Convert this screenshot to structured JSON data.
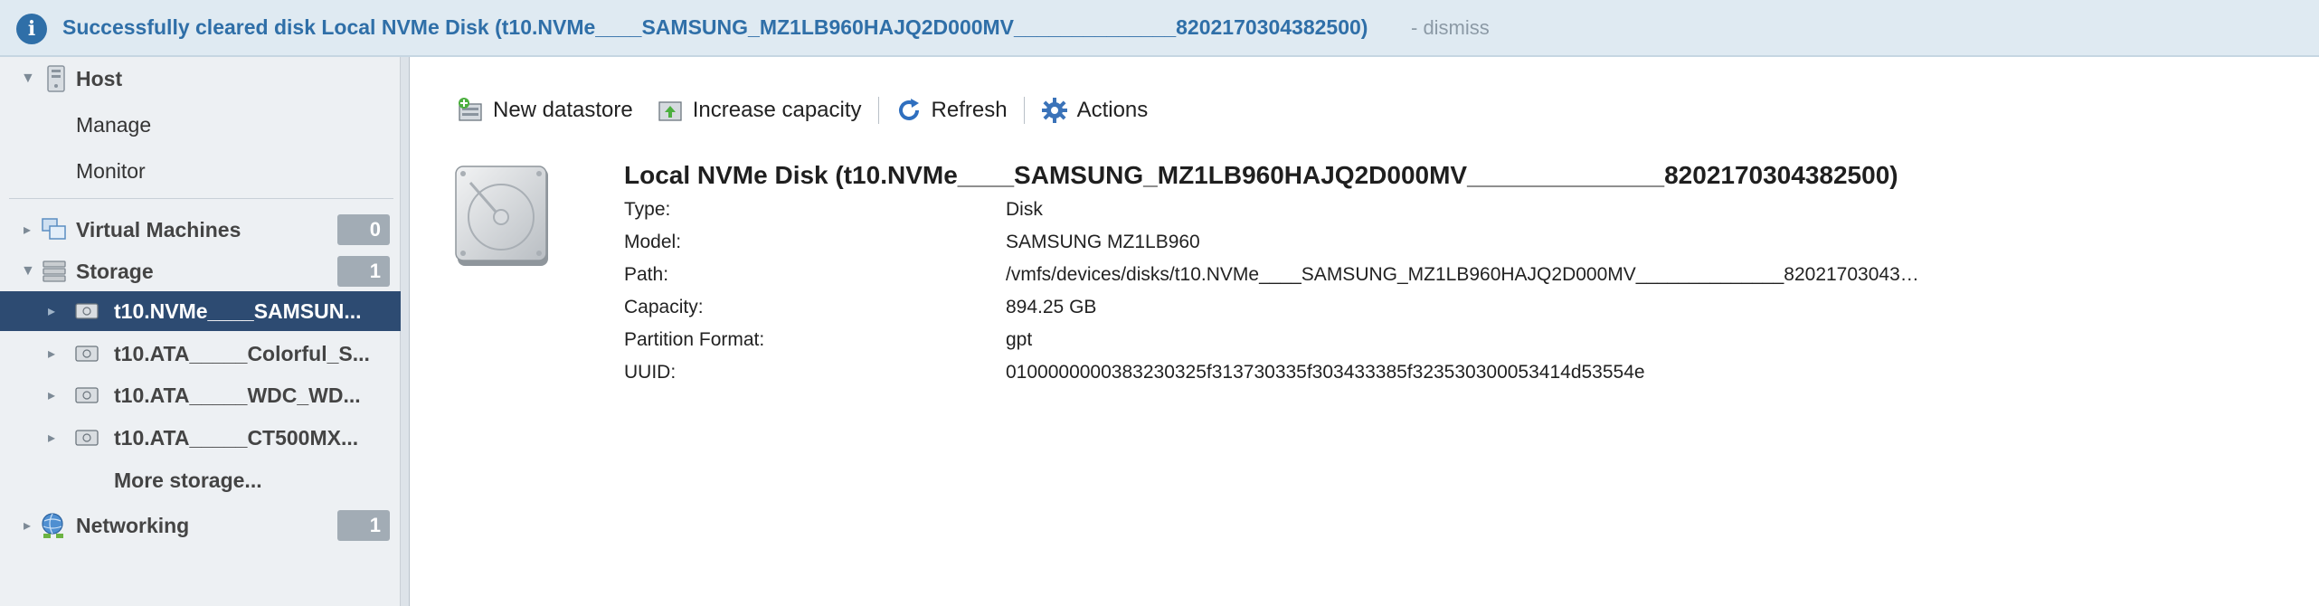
{
  "banner": {
    "message": "Successfully cleared disk Local NVMe Disk (t10.NVMe____SAMSUNG_MZ1LB960HAJQ2D000MV______________8202170304382500)",
    "dismiss": "- dismiss"
  },
  "sidebar": {
    "host": {
      "label": "Host",
      "items": [
        "Manage",
        "Monitor"
      ]
    },
    "virtual_machines": {
      "label": "Virtual Machines",
      "count": "0"
    },
    "storage": {
      "label": "Storage",
      "count": "1",
      "items": [
        "t10.NVMe____SAMSUN...",
        "t10.ATA_____Colorful_S...",
        "t10.ATA_____WDC_WD...",
        "t10.ATA_____CT500MX..."
      ],
      "more": "More storage..."
    },
    "networking": {
      "label": "Networking",
      "count": "1"
    }
  },
  "toolbar": {
    "new_datastore": "New datastore",
    "increase_capacity": "Increase capacity",
    "refresh": "Refresh",
    "actions": "Actions"
  },
  "details": {
    "title": "Local NVMe Disk (t10.NVMe____SAMSUNG_MZ1LB960HAJQ2D000MV______________8202170304382500)",
    "rows": [
      {
        "key": "Type:",
        "value": "Disk"
      },
      {
        "key": "Model:",
        "value": "SAMSUNG MZ1LB960"
      },
      {
        "key": "Path:",
        "value": "/vmfs/devices/disks/t10.NVMe____SAMSUNG_MZ1LB960HAJQ2D000MV______________82021703043…"
      },
      {
        "key": "Capacity:",
        "value": "894.25 GB"
      },
      {
        "key": "Partition Format:",
        "value": "gpt"
      },
      {
        "key": "UUID:",
        "value": "0100000000383230325f313730335f303433385f323530300053414d53554e"
      }
    ]
  },
  "colors": {
    "selection": "#2d4b72",
    "banner_text": "#2f6fa8",
    "badge": "#a2acb5"
  }
}
